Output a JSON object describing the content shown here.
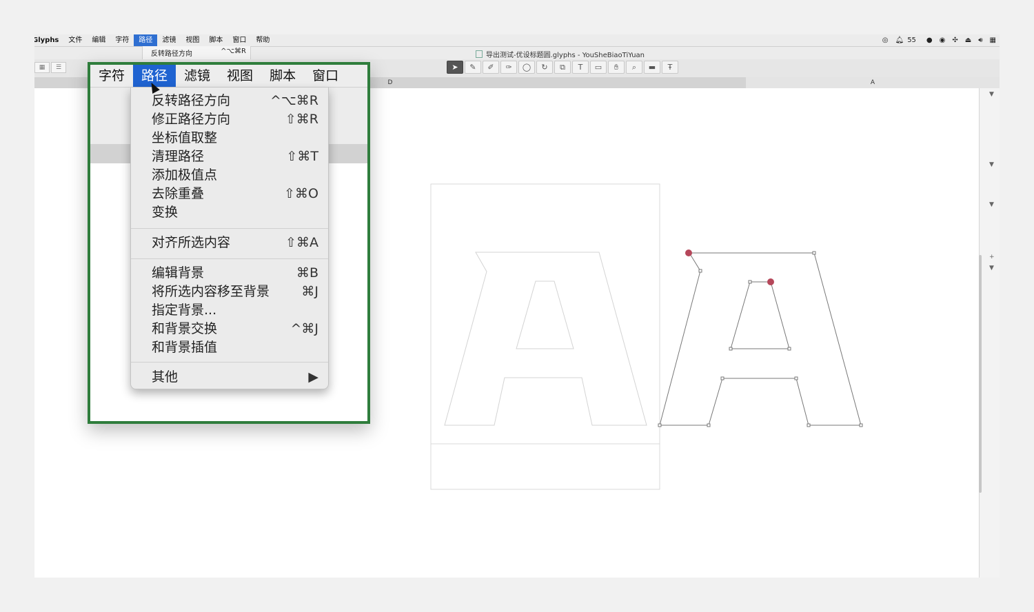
{
  "menubar": {
    "app": "Glyphs",
    "items": [
      "文件",
      "编辑",
      "字符",
      "路径",
      "滤镜",
      "视图",
      "脚本",
      "窗口",
      "帮助"
    ],
    "active_index": 3,
    "status": {
      "notification_count": "55"
    }
  },
  "mini_menu": {
    "label": "反转路径方向",
    "shortcut": "^⌥⌘R"
  },
  "window": {
    "title": "导出测试-优设标题圆.glyphs - YouSheBiaoTiYuan"
  },
  "toolbar": {
    "tool_icons": [
      "select-icon",
      "pen-icon",
      "pencil-icon",
      "brush-icon",
      "ellipse-icon",
      "rotate-icon",
      "scale-icon",
      "text-icon",
      "annotation-icon",
      "hand-icon",
      "zoom-icon",
      "measure-icon",
      "text-tool-icon"
    ]
  },
  "ruler": {
    "left_tab": "D",
    "right_tab": "A"
  },
  "zoom": {
    "bar": [
      "字符",
      "路径",
      "滤镜",
      "视图",
      "脚本",
      "窗口"
    ],
    "active_index": 1,
    "menu": {
      "group1": [
        {
          "label": "反转路径方向",
          "shortcut": "^⌥⌘R"
        },
        {
          "label": "修正路径方向",
          "shortcut": "⇧⌘R"
        },
        {
          "label": "坐标值取整",
          "shortcut": ""
        },
        {
          "label": "清理路径",
          "shortcut": "⇧⌘T"
        },
        {
          "label": "添加极值点",
          "shortcut": ""
        },
        {
          "label": "去除重叠",
          "shortcut": "⇧⌘O"
        },
        {
          "label": "变换",
          "shortcut": ""
        }
      ],
      "group2": [
        {
          "label": "对齐所选内容",
          "shortcut": "⇧⌘A"
        }
      ],
      "group3": [
        {
          "label": "编辑背景",
          "shortcut": "⌘B"
        },
        {
          "label": "将所选内容移至背景",
          "shortcut": "⌘J"
        },
        {
          "label": "指定背景...",
          "shortcut": ""
        },
        {
          "label": "和背景交换",
          "shortcut": "^⌘J"
        },
        {
          "label": "和背景插值",
          "shortcut": ""
        }
      ],
      "group4": [
        {
          "label": "其他",
          "shortcut": "▶"
        }
      ]
    }
  },
  "colors": {
    "accent": "#1f63d1",
    "callout_border": "#2f7d3c",
    "node_selected": "#b5475a"
  }
}
